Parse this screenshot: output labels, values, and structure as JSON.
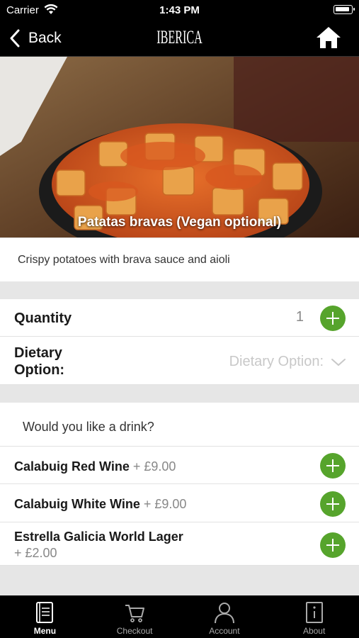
{
  "status_bar": {
    "carrier": "Carrier",
    "time": "1:43 PM"
  },
  "nav": {
    "back_label": "Back",
    "brand": "IBERICA"
  },
  "item": {
    "title": "Patatas bravas (Vegan optional)",
    "description": "Crispy potatoes with brava sauce and aioli"
  },
  "quantity": {
    "label": "Quantity",
    "value": "1"
  },
  "dietary": {
    "label_line1": "Dietary",
    "label_line2": "Option:",
    "placeholder": "Dietary Option:"
  },
  "drinks": {
    "question": "Would you like a drink?",
    "items": [
      {
        "name": "Calabuig Red Wine",
        "price": "+ £9.00"
      },
      {
        "name": "Calabuig White Wine",
        "price": "+ £9.00"
      },
      {
        "name": "Estrella Galicia World Lager",
        "price": "+ £2.00"
      }
    ]
  },
  "tabs": [
    {
      "label": "Menu",
      "icon": "menu-book-icon",
      "active": true
    },
    {
      "label": "Checkout",
      "icon": "cart-icon",
      "active": false
    },
    {
      "label": "Account",
      "icon": "person-icon",
      "active": false
    },
    {
      "label": "About",
      "icon": "info-icon",
      "active": false
    }
  ],
  "colors": {
    "accent_green": "#56a42c",
    "bar_black": "#000000",
    "separator_gray": "#e6e6e6"
  }
}
